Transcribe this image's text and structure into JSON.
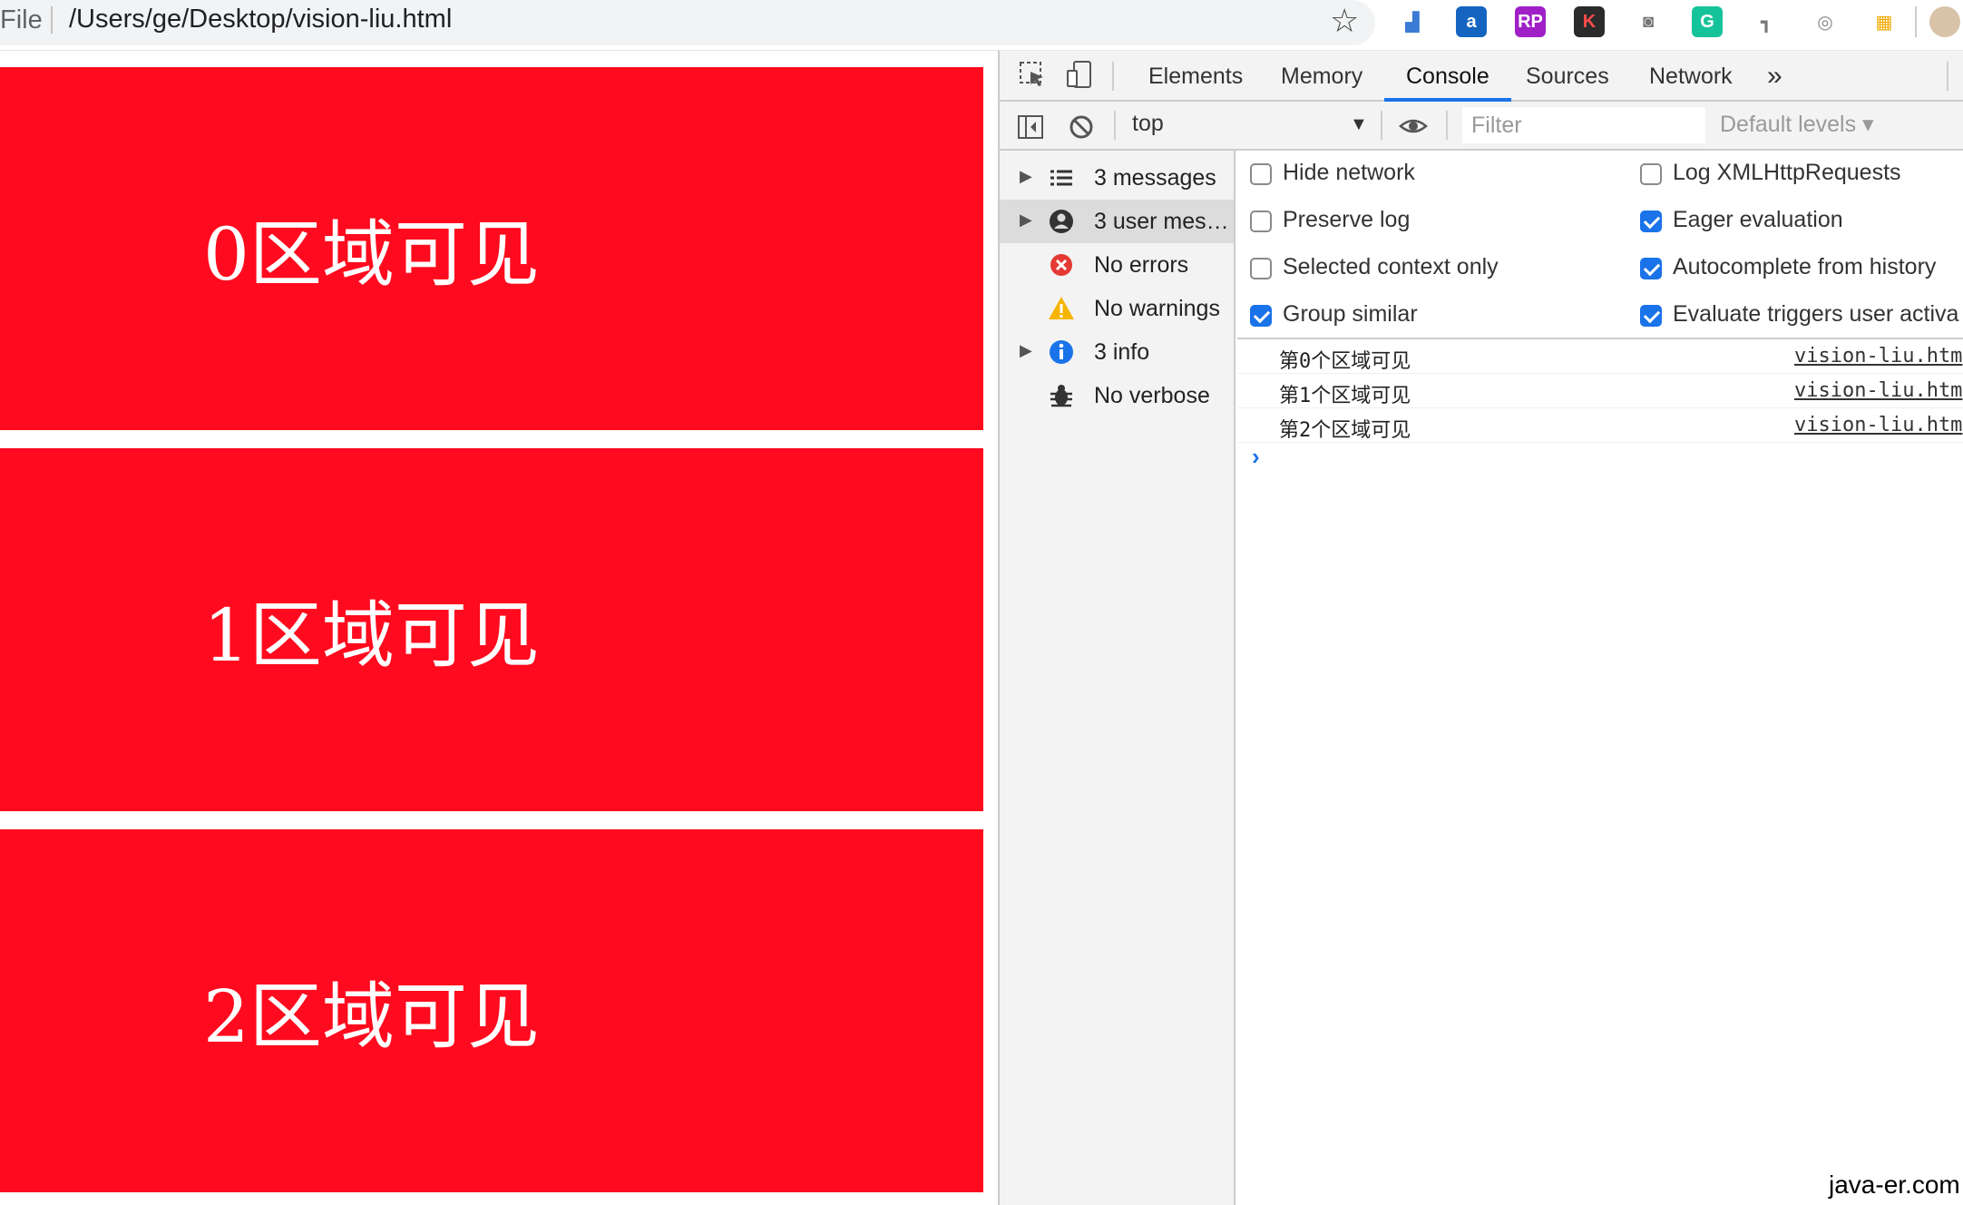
{
  "browser": {
    "scheme_label": "File",
    "url": "/Users/ge/Desktop/vision-liu.html",
    "bookmark_icon": "star-icon",
    "extensions": [
      {
        "name": "chart-extension-icon",
        "glyph": "▟",
        "bg": "#ffffff",
        "fg": "#3a7bd5"
      },
      {
        "name": "a-extension-icon",
        "glyph": "a",
        "bg": "#1565c0",
        "fg": "#ffffff"
      },
      {
        "name": "rp-extension-icon",
        "glyph": "RP",
        "bg": "#a020c8",
        "fg": "#ffffff"
      },
      {
        "name": "k-extension-icon",
        "glyph": "K",
        "bg": "#2b2b2b",
        "fg": "#ff4d4d"
      },
      {
        "name": "camera-extension-icon",
        "glyph": "◙",
        "bg": "#ffffff",
        "fg": "#777777"
      },
      {
        "name": "grammarly-extension-icon",
        "glyph": "G",
        "bg": "#15c39a",
        "fg": "#ffffff"
      },
      {
        "name": "puzzle-extension-icon",
        "glyph": "┓",
        "bg": "#ffffff",
        "fg": "#777777"
      },
      {
        "name": "chrome-extension-icon",
        "glyph": "◎",
        "bg": "#ffffff",
        "fg": "#888888"
      },
      {
        "name": "grid-extension-icon",
        "glyph": "▦",
        "bg": "#ffffff",
        "fg": "#f0a800"
      }
    ]
  },
  "page": {
    "regions": [
      {
        "text": "0区域可见"
      },
      {
        "text": "1区域可见"
      },
      {
        "text": "2区域可见"
      }
    ],
    "region_color": "#ff0a1e"
  },
  "devtools": {
    "tabs": [
      {
        "label": "Elements",
        "name": "tab-elements",
        "active": false
      },
      {
        "label": "Memory",
        "name": "tab-memory",
        "active": false
      },
      {
        "label": "Console",
        "name": "tab-console",
        "active": true
      },
      {
        "label": "Sources",
        "name": "tab-sources",
        "active": false
      },
      {
        "label": "Network",
        "name": "tab-network",
        "active": false
      }
    ],
    "more_tabs": "»",
    "toolbar": {
      "context": "top",
      "context_caret": "▼",
      "filter_placeholder": "Filter",
      "levels": "Default levels ▾"
    },
    "sidebar": [
      {
        "label": "3 messages",
        "icon": "list-icon",
        "expandable": true,
        "selected": false
      },
      {
        "label": "3 user mes…",
        "icon": "user-icon",
        "expandable": true,
        "selected": true
      },
      {
        "label": "No errors",
        "icon": "error-icon",
        "expandable": false,
        "selected": false
      },
      {
        "label": "No warnings",
        "icon": "warning-icon",
        "expandable": false,
        "selected": false
      },
      {
        "label": "3 info",
        "icon": "info-icon",
        "expandable": true,
        "selected": false
      },
      {
        "label": "No verbose",
        "icon": "bug-icon",
        "expandable": false,
        "selected": false
      }
    ],
    "settings_left": [
      {
        "label": "Hide network",
        "checked": false
      },
      {
        "label": "Preserve log",
        "checked": false
      },
      {
        "label": "Selected context only",
        "checked": false
      },
      {
        "label": "Group similar",
        "checked": true
      }
    ],
    "settings_right": [
      {
        "label": "Log XMLHttpRequests",
        "checked": false
      },
      {
        "label": "Eager evaluation",
        "checked": true
      },
      {
        "label": "Autocomplete from history",
        "checked": true
      },
      {
        "label": "Evaluate triggers user activa",
        "checked": true
      }
    ],
    "messages": [
      {
        "text": "第0个区域可见",
        "source": "vision-liu.htm"
      },
      {
        "text": "第1个区域可见",
        "source": "vision-liu.htm"
      },
      {
        "text": "第2个区域可见",
        "source": "vision-liu.htm"
      }
    ],
    "prompt": "›"
  },
  "watermark": "java-er.com",
  "colors": {
    "accent": "#1a73e8",
    "error": "#e53935",
    "warning": "#f5b400",
    "info": "#1a73e8"
  }
}
